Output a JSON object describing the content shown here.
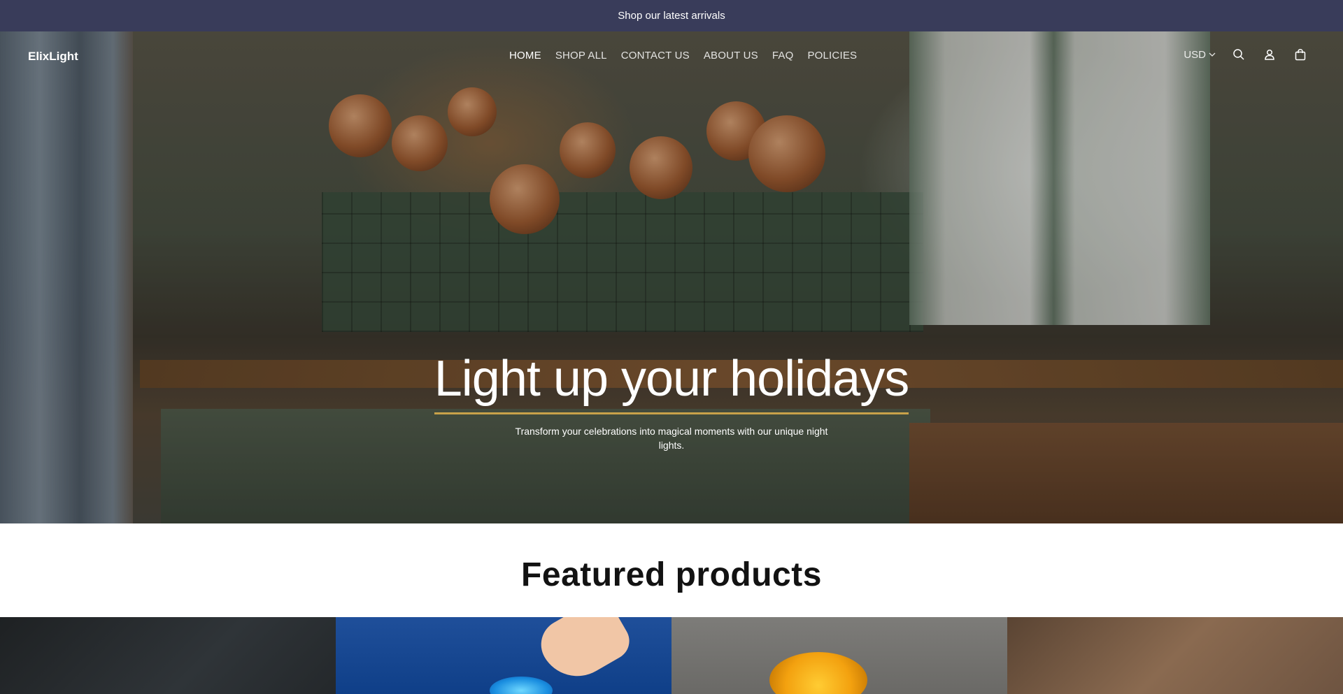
{
  "announcement": {
    "text": "Shop our latest arrivals"
  },
  "header": {
    "logo": "ElixLight",
    "nav": [
      {
        "label": "HOME",
        "active": true
      },
      {
        "label": "SHOP ALL",
        "active": false
      },
      {
        "label": "CONTACT US",
        "active": false
      },
      {
        "label": "ABOUT US",
        "active": false
      },
      {
        "label": "FAQ",
        "active": false
      },
      {
        "label": "POLICIES",
        "active": false
      }
    ],
    "currency": "USD",
    "icons": [
      "search-icon",
      "account-icon",
      "cart-icon"
    ]
  },
  "hero": {
    "title": "Light up your holidays",
    "subtitle": "Transform your celebrations into magical moments with our unique night lights.",
    "accent_color": "#c8a24a"
  },
  "featured": {
    "title": "Featured products"
  },
  "colors": {
    "announcement_bg": "#393c5a",
    "text_dark": "#121212"
  }
}
